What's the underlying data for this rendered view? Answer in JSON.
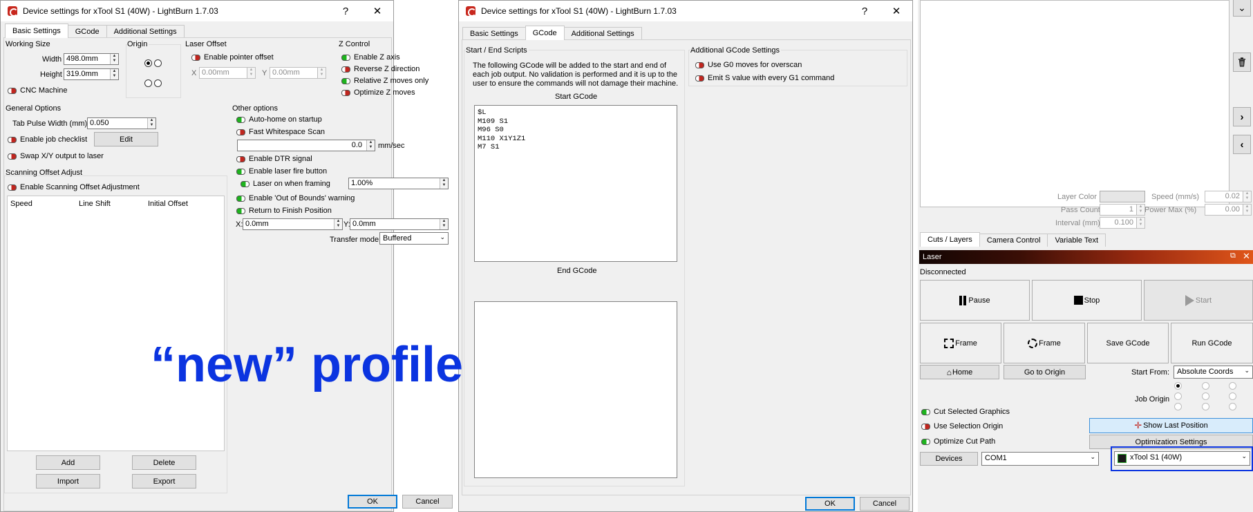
{
  "dialog1": {
    "title": "Device settings for xTool S1 (40W) - LightBurn 1.7.03",
    "help": "?",
    "close": "✕",
    "tabs": [
      "Basic Settings",
      "GCode",
      "Additional Settings"
    ],
    "working_size": {
      "title": "Working Size",
      "width_label": "Width",
      "width": "498.0mm",
      "height_label": "Height",
      "height": "319.0mm",
      "cnc_label": "CNC Machine"
    },
    "origin": {
      "title": "Origin"
    },
    "laser_offset": {
      "title": "Laser Offset",
      "enable_label": "Enable pointer offset",
      "x_label": "X",
      "x": "0.00mm",
      "y_label": "Y",
      "y": "0.00mm"
    },
    "z_control": {
      "title": "Z Control",
      "items": [
        "Enable Z axis",
        "Reverse Z direction",
        "Relative Z moves only",
        "Optimize Z moves"
      ]
    },
    "general": {
      "title": "General Options",
      "tab_pulse_label": "Tab Pulse Width (mm)",
      "tab_pulse": "0.050",
      "checklist_label": "Enable job checklist",
      "edit": "Edit",
      "swap_label": "Swap X/Y output to laser"
    },
    "other": {
      "title": "Other options",
      "autohome": "Auto-home on startup",
      "fast_ws": "Fast Whitespace Scan",
      "speed_value": "0.0",
      "speed_unit": "mm/sec",
      "dtr": "Enable DTR signal",
      "fire_btn": "Enable laser fire button",
      "framing_label": "Laser on when framing",
      "framing_value": "1.00%",
      "oob": "Enable 'Out of Bounds' warning",
      "finish": "Return to Finish Position",
      "x_label": "X:",
      "x": "0.0mm",
      "y_label": "Y:",
      "y": "0.0mm",
      "transfer_label": "Transfer mode",
      "transfer": "Buffered"
    },
    "scan": {
      "title": "Scanning Offset Adjust",
      "enable": "Enable Scanning Offset Adjustment",
      "columns": [
        "Speed",
        "Line Shift",
        "Initial Offset"
      ],
      "add": "Add",
      "delete": "Delete",
      "import": "Import",
      "export": "Export"
    },
    "ok": "OK",
    "cancel": "Cancel"
  },
  "dialog2": {
    "title": "Device settings for xTool S1 (40W) - LightBurn 1.7.03",
    "help": "?",
    "close": "✕",
    "tabs": [
      "Basic Settings",
      "GCode",
      "Additional Settings"
    ],
    "scripts_title": "Start / End Scripts",
    "description": "The following GCode will be added to the start and end of\neach job output. No validation is performed and it is up to the\nuser to ensure the commands will not damage their machine.",
    "start_label": "Start GCode",
    "start_code": "$L\nM109 S1\nM96 S0\nM110 X1Y1Z1\nM7 S1",
    "end_label": "End GCode",
    "end_code": "",
    "additional_title": "Additional GCode Settings",
    "g0": "Use G0 moves for overscan",
    "emit_s": "Emit S value with every G1 command",
    "ok": "OK",
    "cancel": "Cancel"
  },
  "right": {
    "tool_icons": [
      "chevron-down-icon",
      "trash-icon",
      "chevron-right-icon",
      "chevron-left-icon"
    ],
    "props": {
      "layer_color": "Layer Color",
      "speed_label": "Speed (mm/s)",
      "speed": "0.02",
      "pass_label": "Pass Count",
      "pass": "1",
      "power_label": "Power Max (%)",
      "power": "0.00",
      "interval_label": "Interval (mm)",
      "interval": "0.100"
    },
    "tabs": [
      "Cuts / Layers",
      "Camera Control",
      "Variable Text"
    ],
    "laser_title": "Laser",
    "status": "Disconnected",
    "pause": "Pause",
    "stop": "Stop",
    "start": "Start",
    "frame1": "Frame",
    "frame2": "Frame",
    "save_gcode": "Save GCode",
    "run_gcode": "Run GCode",
    "home": "Home",
    "go_origin": "Go to Origin",
    "start_from_label": "Start From:",
    "start_from": "Absolute Coords",
    "job_origin": "Job Origin",
    "cut_selected": "Cut Selected Graphics",
    "use_selection": "Use Selection Origin",
    "optimize": "Optimize Cut Path",
    "show_last": "Show Last Position",
    "opt_settings": "Optimization Settings",
    "devices": "Devices",
    "port": "COM1",
    "device": "xTool S1 (40W)"
  },
  "overlay_text": "“new” profile",
  "colors": {
    "highlight": "#0b34e0",
    "laser_bar_start": "#1a0a05",
    "laser_bar_end": "#e0561a"
  }
}
